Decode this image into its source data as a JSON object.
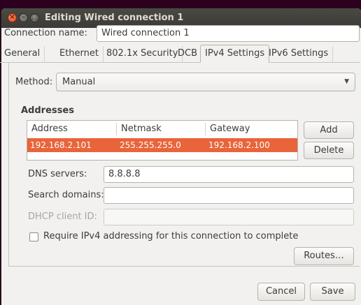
{
  "window": {
    "title": "Editing Wired connection 1"
  },
  "connection": {
    "name_label": "Connection name:",
    "name_value": "Wired connection 1"
  },
  "tabs": [
    {
      "label": "General"
    },
    {
      "label": "Ethernet"
    },
    {
      "label": "802.1x Security"
    },
    {
      "label": "DCB"
    },
    {
      "label": "IPv4 Settings",
      "active": true
    },
    {
      "label": "IPv6 Settings"
    }
  ],
  "ipv4": {
    "method_label": "Method:",
    "method_value": "Manual",
    "addresses_heading": "Addresses",
    "columns": [
      "Address",
      "Netmask",
      "Gateway"
    ],
    "rows": [
      {
        "address": "192.168.2.101",
        "netmask": "255.255.255.0",
        "gateway": "192.168.2.100",
        "selected": true
      }
    ],
    "add_label": "Add",
    "delete_label": "Delete",
    "dns_label": "DNS servers:",
    "dns_value": "8.8.8.8",
    "search_label": "Search domains:",
    "search_value": "",
    "dhcp_label": "DHCP client ID:",
    "dhcp_value": "",
    "require_label": "Require IPv4 addressing for this connection to complete",
    "require_checked": false,
    "routes_label": "Routes…"
  },
  "footer": {
    "cancel_label": "Cancel",
    "save_label": "Save"
  },
  "colors": {
    "accent": "#e9643a",
    "titlebar": "#3c3b37",
    "close_button": "#df4a16",
    "background": "#f2f1f0"
  }
}
